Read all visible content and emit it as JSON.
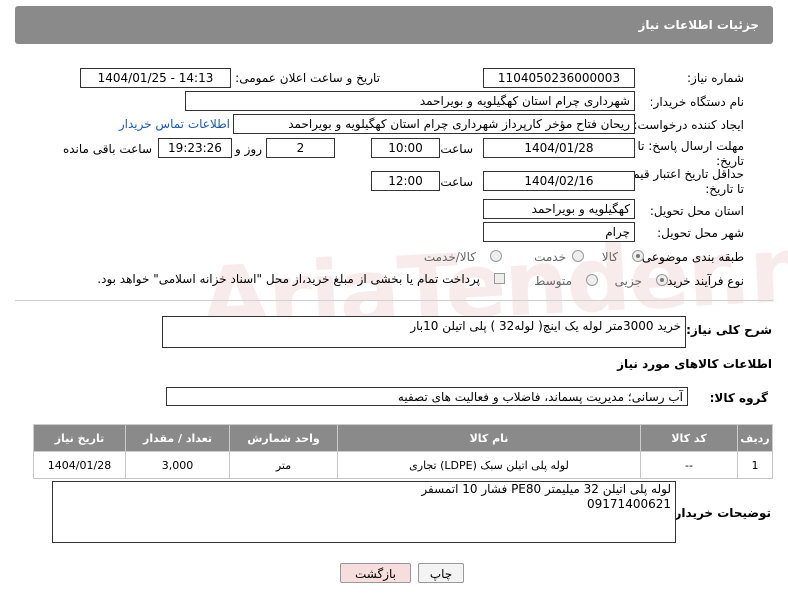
{
  "header": {
    "title": "جزئیات اطلاعات نیاز"
  },
  "form": {
    "need_number_label": "شماره نیاز:",
    "need_number": "1104050236000003",
    "announce_label": "تاریخ و ساعت اعلان عمومی:",
    "announce_value": "1404/01/25 - 14:13",
    "buyer_org_label": "نام دستگاه خریدار:",
    "buyer_org": "شهرداری چرام استان کهگیلویه و بویراحمد",
    "creator_label": "ایجاد کننده درخواست:",
    "creator": "ریحان فتاح مؤخر کارپرداز شهرداری چرام استان کهگیلویه و بویراحمد",
    "contact_link": "اطلاعات تماس خریدار",
    "reply_deadline_label": "مهلت ارسال پاسخ: تا تاریخ:",
    "reply_date": "1404/01/28",
    "time_label": "ساعت",
    "reply_time": "10:00",
    "days_value": "2",
    "days_label": "روز و",
    "remaining_time": "19:23:26",
    "remaining_label": "ساعت باقی مانده",
    "price_validity_label": "حداقل تاریخ اعتبار قیمت: تا تاریخ:",
    "price_date": "1404/02/16",
    "price_time": "12:00",
    "delivery_province_label": "استان محل تحویل:",
    "delivery_province": "کهگیلویه و بویراحمد",
    "delivery_city_label": "شهر محل تحویل:",
    "delivery_city": "چرام",
    "category_label": "طبقه بندی موضوعی:",
    "category_options": [
      "کالا",
      "خدمت",
      "کالا/خدمت"
    ],
    "process_label": "نوع فرآیند خرید :",
    "process_options": [
      "جزیی",
      "متوسط"
    ],
    "payment_note": "پرداخت تمام یا بخشی از مبلغ خرید،از محل \"اسناد خزانه اسلامی\" خواهد بود."
  },
  "description": {
    "label": "شرح کلی نیاز:",
    "text": "خرید 3000متر لوله یک اینچ( لوله32 ) پلی اتیلن 10بار"
  },
  "goods_info_title": "اطلاعات کالاهای مورد نیاز",
  "goods_group": {
    "label": "گروه کالا:",
    "value": "آب رسانی؛ مدیریت پسماند، فاضلاب و فعالیت های تصفیه"
  },
  "table": {
    "headers": [
      "ردیف",
      "کد کالا",
      "نام کالا",
      "واحد شمارش",
      "تعداد / مقدار",
      "تاریخ نیاز"
    ],
    "rows": [
      [
        "1",
        "--",
        "لوله پلی اتیلن سبک (LDPE) تجاری",
        "متر",
        "3,000",
        "1404/01/28"
      ]
    ]
  },
  "buyer_notes": {
    "label": "توضیحات خریدار:",
    "line1": "لوله پلی اتیلن 32 میلیمتر PE80 فشار 10 اتمسفر",
    "line2": "09171400621"
  },
  "buttons": {
    "print": "چاپ",
    "back": "بازگشت"
  },
  "colors": {
    "header_bg": "#8a8a8a",
    "link": "#1a5bb8",
    "back_button_bg": "#f7dede"
  }
}
